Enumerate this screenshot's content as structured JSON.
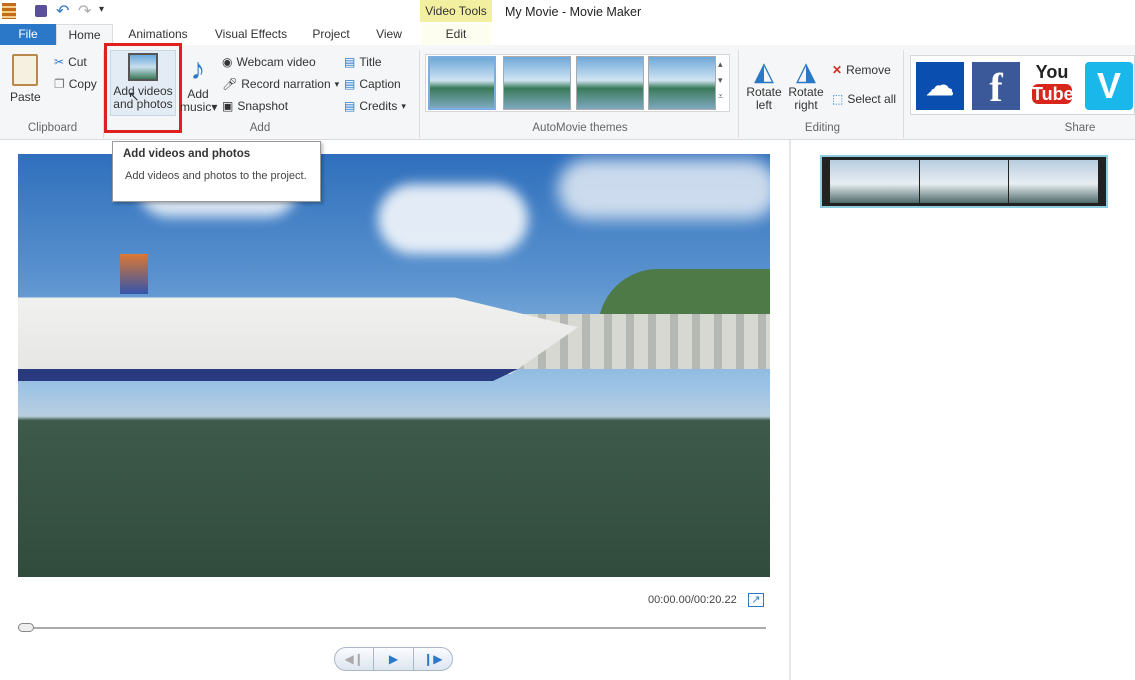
{
  "window": {
    "title": "My Movie - Movie Maker",
    "context_tab_group": "Video Tools"
  },
  "tabs": [
    "File",
    "Home",
    "Animations",
    "Visual Effects",
    "Project",
    "View",
    "Edit"
  ],
  "clipboard": {
    "paste": "Paste",
    "cut": "Cut",
    "copy": "Copy",
    "group": "Clipboard"
  },
  "add": {
    "add_videos_line1": "Add videos",
    "add_videos_line2": "and photos",
    "add_music_line1": "Add",
    "add_music_line2": "music",
    "webcam": "Webcam video",
    "narration": "Record narration",
    "snapshot": "Snapshot",
    "title": "Title",
    "caption": "Caption",
    "credits": "Credits",
    "group": "Add"
  },
  "themes": {
    "group": "AutoMovie themes"
  },
  "editing": {
    "rotate_left_1": "Rotate",
    "rotate_left_2": "left",
    "rotate_right_1": "Rotate",
    "rotate_right_2": "right",
    "remove": "Remove",
    "select_all": "Select all",
    "group": "Editing"
  },
  "share": {
    "group": "Share",
    "services": [
      "onedrive-icon",
      "facebook-icon",
      "youtube-icon",
      "vimeo-icon"
    ],
    "youtube_1": "You",
    "youtube_2": "Tube",
    "facebook": "f",
    "vimeo": "V"
  },
  "tooltip": {
    "title": "Add videos and photos",
    "body": "Add videos and photos to the project."
  },
  "player": {
    "time": "00:00.00/00:20.22",
    "progress": 0
  },
  "colors": {
    "file_tab": "#2b78c8",
    "highlight": "#e02020",
    "context": "#f2f0a0"
  }
}
